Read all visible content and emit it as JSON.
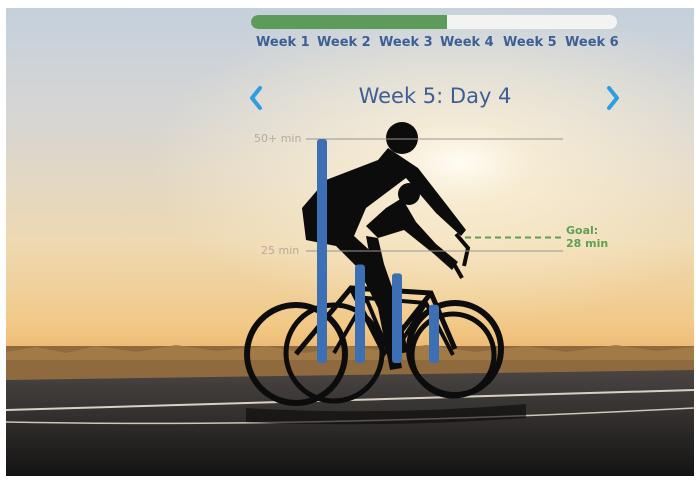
{
  "progress": {
    "fraction": 0.535,
    "fill_color": "#5d9b5a",
    "track_color": "#f3f3f1"
  },
  "weeks": [
    "Week 1",
    "Week 2",
    "Week 3",
    "Week 4",
    "Week 5",
    "Week 6"
  ],
  "nav": {
    "title": "Week 5: Day 4",
    "prev_icon": "chevron-left-icon",
    "next_icon": "chevron-right-icon",
    "arrow_color": "#2f9ee0"
  },
  "chart_data": {
    "type": "bar",
    "y_ticks": [
      "50+ min",
      "25 min"
    ],
    "values": [
      50,
      22,
      20,
      13
    ],
    "ylim": [
      0,
      50
    ],
    "goal": {
      "label": "Goal:",
      "value_label": "28 min",
      "value": 28
    },
    "bar_color": "#3d6fb5",
    "goal_color": "#5fa052"
  }
}
